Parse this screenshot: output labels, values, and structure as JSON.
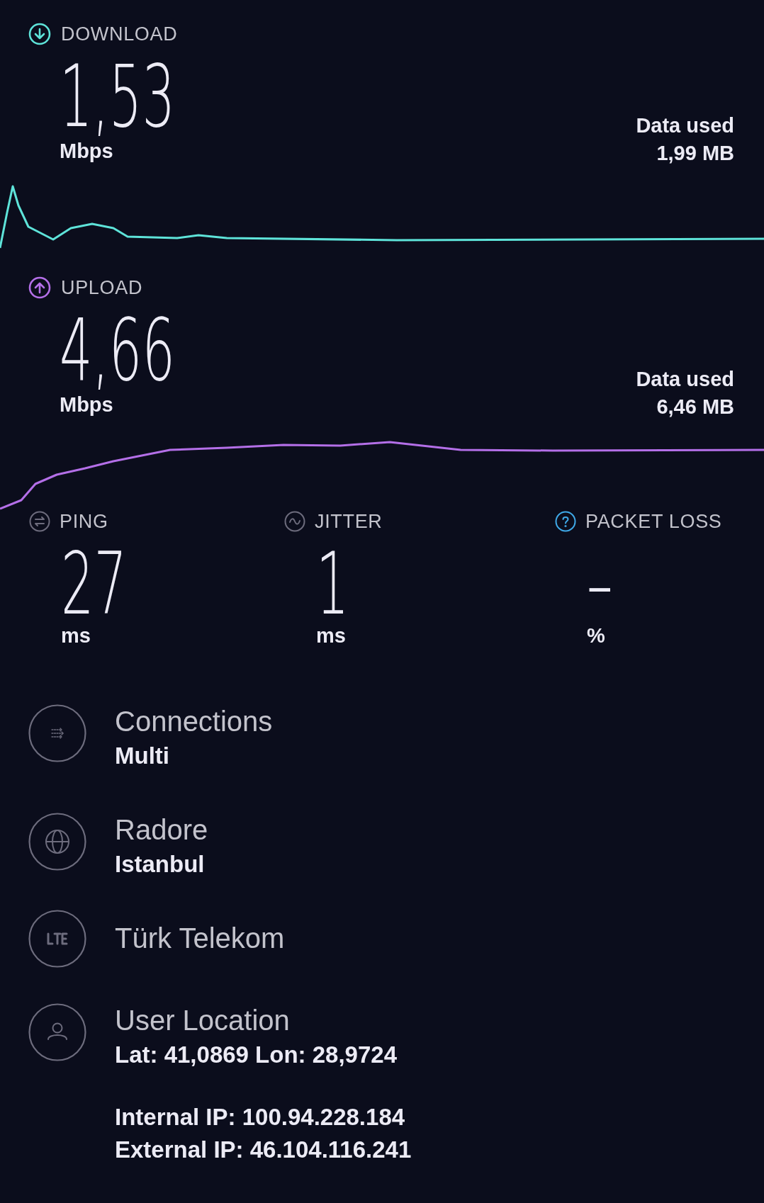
{
  "tests": [
    {
      "kind": "download",
      "label": "DOWNLOAD",
      "color": "#5ee3d9",
      "value": "1,53",
      "unit": "Mbps",
      "data_used_label": "Data used",
      "data_used": "1,99 MB"
    },
    {
      "kind": "upload",
      "label": "UPLOAD",
      "color": "#b46fe8",
      "value": "4,66",
      "unit": "Mbps",
      "data_used_label": "Data used",
      "data_used": "6,46 MB"
    }
  ],
  "metrics": [
    {
      "kind": "ping",
      "label": "PING",
      "value": "27",
      "unit": "ms"
    },
    {
      "kind": "jitter",
      "label": "JITTER",
      "value": "1",
      "unit": "ms"
    },
    {
      "kind": "packet_loss",
      "label": "PACKET LOSS",
      "value": "–",
      "unit": "%"
    }
  ],
  "info": [
    {
      "kind": "connections",
      "title": "Connections",
      "groups": [
        [
          "Multi"
        ]
      ]
    },
    {
      "kind": "server",
      "title": "Radore",
      "groups": [
        [
          "Istanbul"
        ]
      ]
    },
    {
      "kind": "provider",
      "title": "Türk Telekom"
    },
    {
      "kind": "location",
      "title": "User Location",
      "groups": [
        [
          "Lat: 41,0869 Lon: 28,9724"
        ],
        [
          "Internal IP: 100.94.228.184",
          "External IP: 46.104.116.241"
        ]
      ]
    }
  ]
}
